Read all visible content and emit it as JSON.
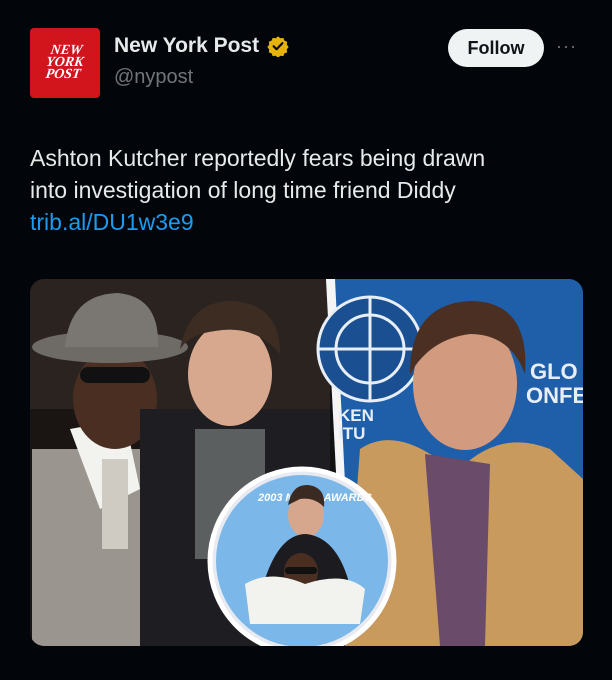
{
  "account": {
    "display_name": "New York Post",
    "handle": "@nypost",
    "logo_text_1": "NEW",
    "logo_text_2": "YORK",
    "logo_text_3": "POST",
    "verified_icon": "verified-gold-badge"
  },
  "actions": {
    "follow_label": "Follow",
    "more_label": "···"
  },
  "tweet": {
    "text_line_1": "Ashton Kutcher reportedly fears being drawn",
    "text_line_2": "into investigation of long time friend Diddy",
    "link": "trib.al/DU1w3e9"
  },
  "media": {
    "sign_text_1": "GLO",
    "sign_text_2": "ONFE",
    "sign_text_3": "KEN",
    "sign_text_4": "ITU",
    "inset_text": "2003 MOVIE AWARDS"
  },
  "colors": {
    "background": "#02060a",
    "link": "#1d9bf0",
    "brand_red": "#d2141c",
    "verified": "#e8b20c"
  }
}
